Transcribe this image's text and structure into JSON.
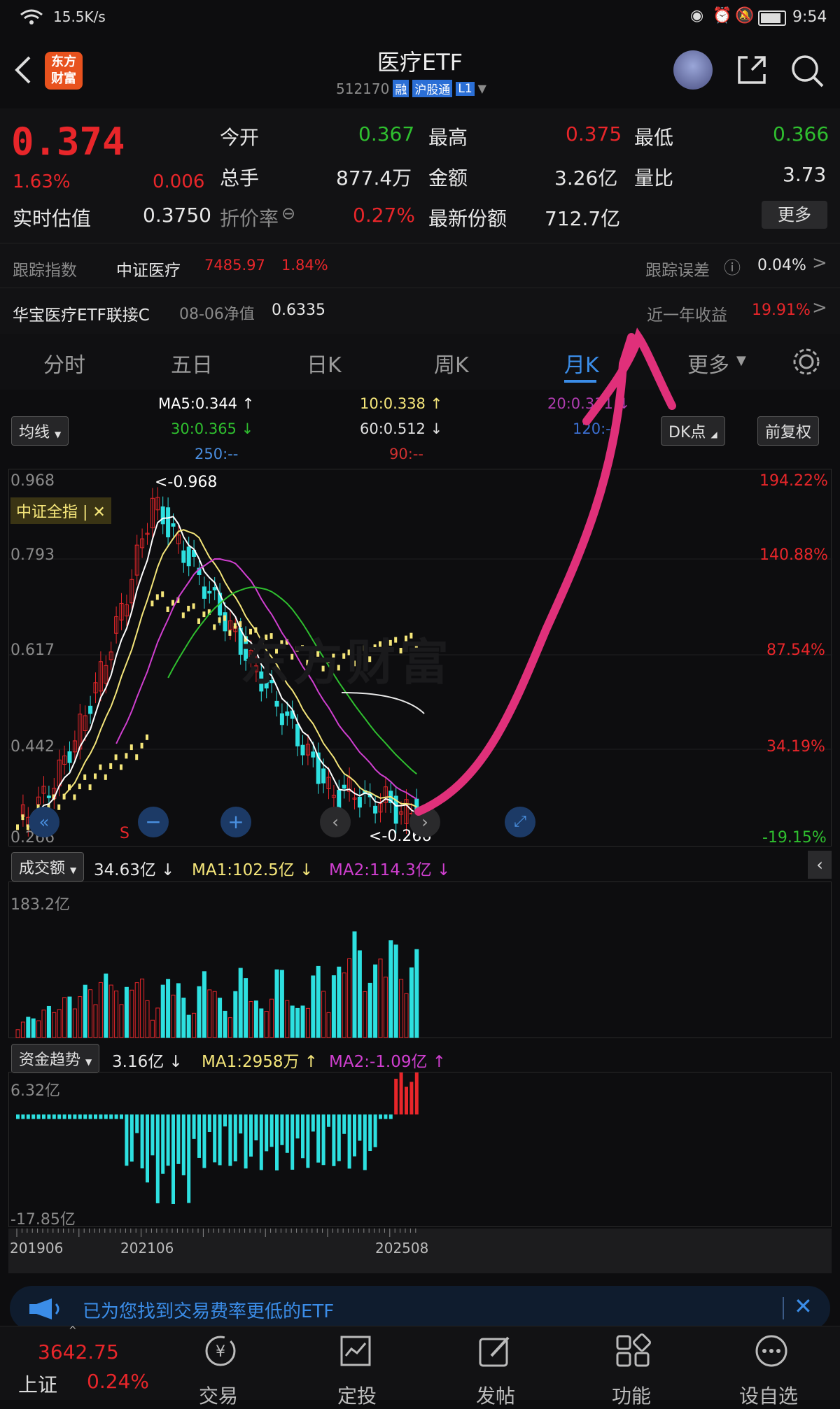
{
  "status": {
    "net_speed": "15.5K/s",
    "time": "9:54"
  },
  "header": {
    "brand_line1": "东方",
    "brand_line2": "财富",
    "title": "医疗ETF",
    "code": "512170",
    "tag1": "融",
    "tag2": "沪股通",
    "tag3": "L1"
  },
  "quote": {
    "price": "0.374",
    "change_pct": "1.63%",
    "change": "0.006",
    "open_label": "今开",
    "open": "0.367",
    "high_label": "最高",
    "high": "0.375",
    "low_label": "最低",
    "low": "0.366",
    "vol_label": "总手",
    "vol": "877.4万",
    "amount_label": "金额",
    "amount": "3.26亿",
    "ratio_label": "量比",
    "ratio": "3.73",
    "est_label": "实时估值",
    "est": "0.3750",
    "premium_label": "折价率",
    "premium": "0.27%",
    "shares_label": "最新份额",
    "shares": "712.7亿",
    "more": "更多",
    "track_label": "跟踪指数",
    "track_name": "中证医疗",
    "track_val": "7485.97",
    "track_pct": "1.84%",
    "err_label": "跟踪误差",
    "err": "0.04%",
    "fund_name": "华宝医疗ETF联接C",
    "nav_label": "08-06净值",
    "nav": "0.6335",
    "year_label": "近一年收益",
    "year": "19.91%"
  },
  "tabs": [
    "分时",
    "五日",
    "日K",
    "周K",
    "月K",
    "更多"
  ],
  "ma": {
    "toggle": "均线",
    "ma5": "MA5:0.344 ↑",
    "ma10": "10:0.338 ↑",
    "ma20": "20:0.331 ↓",
    "ma30": "30:0.365 ↓",
    "ma60": "60:0.512 ↓",
    "ma120": "120:--",
    "ma250": "250:--",
    "ma90": "90:--",
    "dk": "DK点",
    "fq": "前复权"
  },
  "price_chart": {
    "y_labels": [
      "0.968",
      "0.793",
      "0.617",
      "0.442",
      "0.266"
    ],
    "pct_labels": [
      "194.22%",
      "140.88%",
      "87.54%",
      "34.19%",
      "-19.15%"
    ],
    "max_label": "<-0.968",
    "min_label": "<-0.266",
    "index_tag": "中证全指",
    "watermark": "东方财富",
    "s_mark": "S"
  },
  "chart_data": {
    "type": "candlestick",
    "ylim": [
      0.266,
      0.968
    ],
    "x_labels": [
      "201906",
      "202106",
      "202508"
    ],
    "volume": {
      "label": "成交额",
      "value": "34.63亿 ↓",
      "ma1": "MA1:102.5亿 ↓",
      "ma2": "MA2:114.3亿 ↓",
      "max": "183.2亿"
    },
    "flow": {
      "label": "资金趋势",
      "value": "3.16亿 ↓",
      "ma1": "MA1:2958万 ↑",
      "ma2": "MA2:-1.09亿 ↑",
      "max": "6.32亿",
      "min": "-17.85亿"
    }
  },
  "ad": {
    "text": "已为您找到交易费率更低的ETF"
  },
  "bottom": {
    "index_val": "3642.75",
    "index_name": "上证",
    "index_pct": "0.24%",
    "items": [
      "交易",
      "定投",
      "发帖",
      "功能",
      "设自选"
    ]
  },
  "colors": {
    "up": "#e8262a",
    "down": "#2fbf2f",
    "candle_down": "#2de0e0",
    "ma5": "#ffffff",
    "ma10": "#f5e67a",
    "ma20": "#d03fd0",
    "ma30": "#2fbf2f",
    "annotation": "#e0307a"
  }
}
